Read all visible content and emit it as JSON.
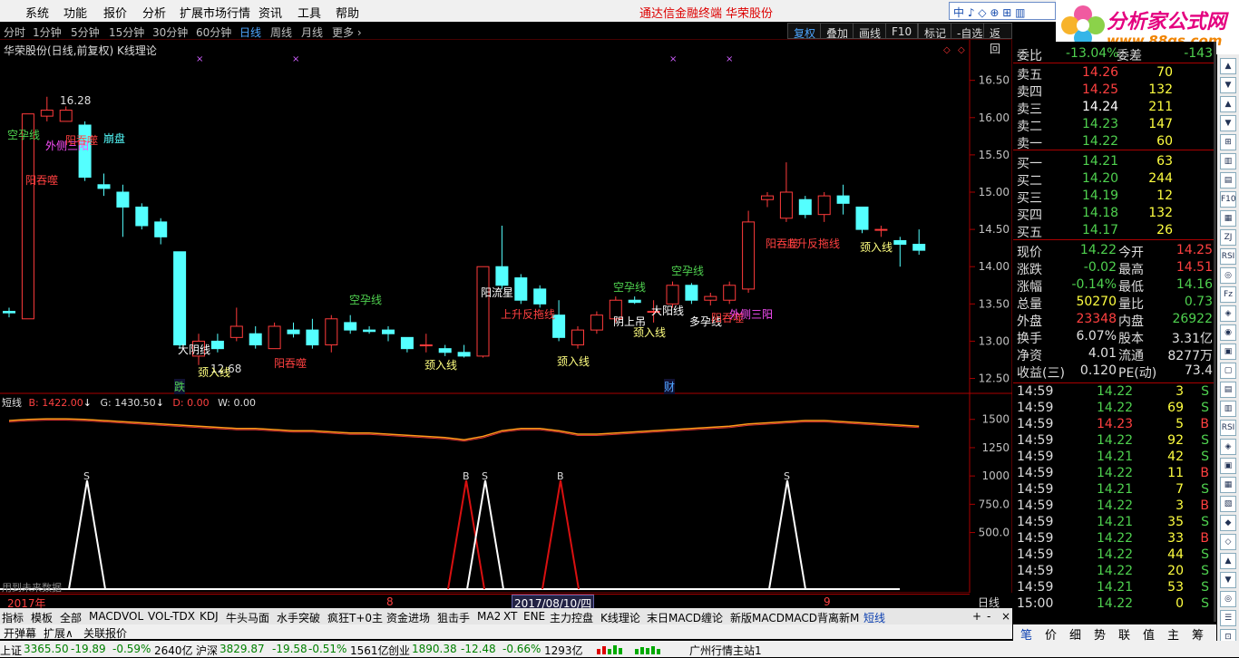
{
  "menu": {
    "items": [
      "系统",
      "功能",
      "报价",
      "分析",
      "扩展市场行情",
      "资讯",
      "工具",
      "帮助"
    ],
    "center_left": "通达信金融终端",
    "center_right": "华荣股份",
    "search_text": "中 ♪ ◇ ⊕ ⊞ ▥",
    "logo_title": "分析家公式网",
    "logo_url": "www.88gs.com"
  },
  "periods": {
    "items": [
      "分时",
      "1分钟",
      "5分钟",
      "15分钟",
      "30分钟",
      "60分钟",
      "日线",
      "周线",
      "月线",
      "更多 ›"
    ],
    "active": "日线",
    "buttons": [
      "复权",
      "叠加",
      "画线",
      "F10",
      "标记",
      "-自选",
      "返回"
    ]
  },
  "chart": {
    "title": "华荣股份(日线,前复权) K线理论",
    "yticks": [
      "16.50",
      "16.00",
      "15.50",
      "15.00",
      "14.50",
      "14.00",
      "13.50",
      "13.00",
      "12.50"
    ],
    "high_label": "16.28",
    "low_label": "12.68",
    "markers": {
      "die": "跌",
      "cai": "财"
    },
    "pattern_labels": [
      {
        "text": "空孕线",
        "x": 8,
        "y": 140,
        "color": "#4fd14f"
      },
      {
        "text": "外侧三阳",
        "x": 50,
        "y": 152,
        "color": "#ff4fff"
      },
      {
        "text": "阳吞噬",
        "x": 72,
        "y": 146,
        "color": "#ff4040"
      },
      {
        "text": "崩盘",
        "x": 114,
        "y": 144,
        "color": "#55ffff"
      },
      {
        "text": "阳吞噬",
        "x": 28,
        "y": 190,
        "color": "#ff4040"
      },
      {
        "text": "空孕线",
        "x": 385,
        "y": 322,
        "color": "#4fd14f"
      },
      {
        "text": "大阴线",
        "x": 196,
        "y": 377,
        "color": "#ffffff"
      },
      {
        "text": "颈入线",
        "x": 218,
        "y": 402,
        "color": "#ffff80"
      },
      {
        "text": "阳吞噬",
        "x": 302,
        "y": 392,
        "color": "#ff4040"
      },
      {
        "text": "颈入线",
        "x": 468,
        "y": 394,
        "color": "#ffff80"
      },
      {
        "text": "阳流星",
        "x": 530,
        "y": 314,
        "color": "#ffffff"
      },
      {
        "text": "上升反拖线",
        "x": 552,
        "y": 338,
        "color": "#ff4040"
      },
      {
        "text": "颈入线",
        "x": 614,
        "y": 390,
        "color": "#ffff80"
      },
      {
        "text": "空孕线",
        "x": 676,
        "y": 308,
        "color": "#4fd14f"
      },
      {
        "text": "阴上吊",
        "x": 676,
        "y": 346,
        "color": "#ffffff"
      },
      {
        "text": "大阳线",
        "x": 718,
        "y": 334,
        "color": "#ffffff"
      },
      {
        "text": "颈入线",
        "x": 698,
        "y": 358,
        "color": "#ffff80"
      },
      {
        "text": "空孕线",
        "x": 740,
        "y": 290,
        "color": "#4fd14f"
      },
      {
        "text": "多孕线",
        "x": 760,
        "y": 346,
        "color": "#ffffff"
      },
      {
        "text": "阳吞噬",
        "x": 784,
        "y": 342,
        "color": "#ff4040"
      },
      {
        "text": "外侧三阳",
        "x": 804,
        "y": 338,
        "color": "#ff4fff"
      },
      {
        "text": "阳吞噬",
        "x": 844,
        "y": 260,
        "color": "#ff4040"
      },
      {
        "text": "上升反拖线",
        "x": 866,
        "y": 260,
        "color": "#ff4040"
      },
      {
        "text": "颈入线",
        "x": 948,
        "y": 264,
        "color": "#ffff80"
      }
    ],
    "xaxis": {
      "year": "2017年",
      "m8": "8",
      "date": "2017/08/10/四",
      "m9": "9",
      "period": "日线"
    },
    "future_note": "用到未来数据"
  },
  "indicator": {
    "name": "短线",
    "b": "B: 1422.00",
    "g": "G: 1430.50",
    "d": "D: 0.00",
    "w": "W: 0.00",
    "yticks": [
      "1500",
      "1250",
      "1000",
      "750.0",
      "500.0"
    ],
    "signal_labels": [
      {
        "text": "S",
        "x": 96
      },
      {
        "text": "B",
        "x": 514
      },
      {
        "text": "S",
        "x": 535
      },
      {
        "text": "B",
        "x": 618
      },
      {
        "text": "S",
        "x": 868
      }
    ]
  },
  "chart_data": {
    "type": "candlestick",
    "title": "华荣股份(日线,前复权) K线理论",
    "ylim": [
      12.3,
      16.8
    ],
    "candles": [
      {
        "o": 13.4,
        "h": 13.45,
        "c": 13.38,
        "l": 13.32
      },
      {
        "o": 13.3,
        "h": 16.05,
        "c": 16.05,
        "l": 13.3
      },
      {
        "o": 16.02,
        "h": 16.28,
        "c": 16.1,
        "l": 15.95
      },
      {
        "o": 15.95,
        "h": 16.15,
        "c": 16.1,
        "l": 15.95
      },
      {
        "o": 15.9,
        "h": 15.95,
        "c": 15.2,
        "l": 15.15
      },
      {
        "o": 15.1,
        "h": 15.25,
        "c": 15.05,
        "l": 14.95
      },
      {
        "o": 15.0,
        "h": 15.1,
        "c": 14.8,
        "l": 14.4
      },
      {
        "o": 14.8,
        "h": 14.85,
        "c": 14.55,
        "l": 14.5
      },
      {
        "o": 14.6,
        "h": 14.65,
        "c": 14.4,
        "l": 14.3
      },
      {
        "o": 14.2,
        "h": 14.2,
        "c": 12.95,
        "l": 12.9
      },
      {
        "o": 12.8,
        "h": 13.1,
        "c": 13.0,
        "l": 12.68
      },
      {
        "o": 13.0,
        "h": 13.1,
        "c": 12.9,
        "l": 12.85
      },
      {
        "o": 13.05,
        "h": 13.45,
        "c": 13.2,
        "l": 13.0
      },
      {
        "o": 13.1,
        "h": 13.2,
        "c": 12.95,
        "l": 12.9
      },
      {
        "o": 12.9,
        "h": 13.25,
        "c": 13.2,
        "l": 12.9
      },
      {
        "o": 13.15,
        "h": 13.25,
        "c": 13.1,
        "l": 13.05
      },
      {
        "o": 13.15,
        "h": 13.3,
        "c": 12.95,
        "l": 12.9
      },
      {
        "o": 12.95,
        "h": 13.35,
        "c": 13.3,
        "l": 12.85
      },
      {
        "o": 13.25,
        "h": 13.35,
        "c": 13.15,
        "l": 13.1
      },
      {
        "o": 13.15,
        "h": 13.2,
        "c": 13.13,
        "l": 13.1
      },
      {
        "o": 13.15,
        "h": 13.2,
        "c": 13.1,
        "l": 13.0
      },
      {
        "o": 13.05,
        "h": 13.05,
        "c": 12.9,
        "l": 12.85
      },
      {
        "o": 12.95,
        "h": 13.1,
        "c": 12.95,
        "l": 12.85
      },
      {
        "o": 12.9,
        "h": 12.95,
        "c": 12.85,
        "l": 12.8
      },
      {
        "o": 12.85,
        "h": 12.95,
        "c": 12.8,
        "l": 12.78
      },
      {
        "o": 12.8,
        "h": 14.0,
        "c": 14.0,
        "l": 12.78
      },
      {
        "o": 14.0,
        "h": 14.55,
        "c": 13.75,
        "l": 13.7
      },
      {
        "o": 13.85,
        "h": 13.9,
        "c": 13.55,
        "l": 13.5
      },
      {
        "o": 13.7,
        "h": 13.75,
        "c": 13.5,
        "l": 13.45
      },
      {
        "o": 13.35,
        "h": 13.55,
        "c": 13.05,
        "l": 13.0
      },
      {
        "o": 12.95,
        "h": 13.2,
        "c": 13.15,
        "l": 12.9
      },
      {
        "o": 13.15,
        "h": 13.4,
        "c": 13.35,
        "l": 13.1
      },
      {
        "o": 13.3,
        "h": 13.6,
        "c": 13.55,
        "l": 13.25
      },
      {
        "o": 13.55,
        "h": 13.6,
        "c": 13.52,
        "l": 13.5
      },
      {
        "o": 13.4,
        "h": 13.55,
        "c": 13.4,
        "l": 13.25
      },
      {
        "o": 13.5,
        "h": 13.8,
        "c": 13.75,
        "l": 13.45
      },
      {
        "o": 13.75,
        "h": 13.78,
        "c": 13.55,
        "l": 13.5
      },
      {
        "o": 13.55,
        "h": 13.65,
        "c": 13.6,
        "l": 13.48
      },
      {
        "o": 13.55,
        "h": 13.8,
        "c": 13.75,
        "l": 13.5
      },
      {
        "o": 13.7,
        "h": 14.75,
        "c": 14.6,
        "l": 13.65
      },
      {
        "o": 14.9,
        "h": 15.0,
        "c": 14.95,
        "l": 14.8
      },
      {
        "o": 14.65,
        "h": 15.4,
        "c": 15.0,
        "l": 14.6
      },
      {
        "o": 14.9,
        "h": 14.95,
        "c": 14.7,
        "l": 14.65
      },
      {
        "o": 14.7,
        "h": 15.0,
        "c": 14.95,
        "l": 14.6
      },
      {
        "o": 14.95,
        "h": 15.1,
        "c": 14.85,
        "l": 14.7
      },
      {
        "o": 14.8,
        "h": 14.8,
        "c": 14.5,
        "l": 14.45
      },
      {
        "o": 14.5,
        "h": 14.55,
        "c": 14.5,
        "l": 14.4
      },
      {
        "o": 14.35,
        "h": 14.4,
        "c": 14.3,
        "l": 14.0
      },
      {
        "o": 14.3,
        "h": 14.5,
        "c": 14.22,
        "l": 14.16
      }
    ],
    "indicator_line_b": [
      1490,
      1500,
      1505,
      1505,
      1500,
      1490,
      1480,
      1470,
      1460,
      1450,
      1440,
      1430,
      1420,
      1420,
      1410,
      1400,
      1400,
      1390,
      1380,
      1380,
      1370,
      1360,
      1350,
      1340,
      1320,
      1350,
      1400,
      1420,
      1420,
      1400,
      1370,
      1370,
      1380,
      1390,
      1400,
      1410,
      1420,
      1430,
      1440,
      1460,
      1470,
      1480,
      1490,
      1490,
      1480,
      1470,
      1460,
      1450,
      1440
    ],
    "signals": [
      {
        "type": "S",
        "index": 4
      },
      {
        "type": "B",
        "index": 24
      },
      {
        "type": "S",
        "index": 25
      },
      {
        "type": "B",
        "index": 29
      },
      {
        "type": "S",
        "index": 41
      }
    ]
  },
  "quote": {
    "weibi_label": "委比",
    "weibi": "-13.04%",
    "weicha_label": "委差",
    "weicha": "-143",
    "asks": [
      {
        "label": "卖五",
        "price": "14.26",
        "vol": "70"
      },
      {
        "label": "卖四",
        "price": "14.25",
        "vol": "132"
      },
      {
        "label": "卖三",
        "price": "14.24",
        "vol": "211"
      },
      {
        "label": "卖二",
        "price": "14.23",
        "vol": "147"
      },
      {
        "label": "卖一",
        "price": "14.22",
        "vol": "60"
      }
    ],
    "bids": [
      {
        "label": "买一",
        "price": "14.21",
        "vol": "63"
      },
      {
        "label": "买二",
        "price": "14.20",
        "vol": "244"
      },
      {
        "label": "买三",
        "price": "14.19",
        "vol": "12"
      },
      {
        "label": "买四",
        "price": "14.18",
        "vol": "132"
      },
      {
        "label": "买五",
        "price": "14.17",
        "vol": "26"
      }
    ],
    "stats": [
      {
        "l1": "现价",
        "v1": "14.22",
        "c1": "#4fd14f",
        "l2": "今开",
        "v2": "14.25",
        "c2": "#ff4040"
      },
      {
        "l1": "涨跌",
        "v1": "-0.02",
        "c1": "#4fd14f",
        "l2": "最高",
        "v2": "14.51",
        "c2": "#ff4040"
      },
      {
        "l1": "涨幅",
        "v1": "-0.14%",
        "c1": "#4fd14f",
        "l2": "最低",
        "v2": "14.16",
        "c2": "#4fd14f"
      },
      {
        "l1": "总量",
        "v1": "50270",
        "c1": "#ffff40",
        "l2": "量比",
        "v2": "0.73",
        "c2": "#4fd14f"
      },
      {
        "l1": "外盘",
        "v1": "23348",
        "c1": "#ff4040",
        "l2": "内盘",
        "v2": "26922",
        "c2": "#4fd14f"
      },
      {
        "l1": "换手",
        "v1": "6.07%",
        "c1": "#e0e0e0",
        "l2": "股本",
        "v2": "3.31亿",
        "c2": "#e0e0e0"
      },
      {
        "l1": "净资",
        "v1": "4.01",
        "c1": "#e0e0e0",
        "l2": "流通",
        "v2": "8277万",
        "c2": "#e0e0e0"
      },
      {
        "l1": "收益(三)",
        "v1": "0.120",
        "c1": "#e0e0e0",
        "l2": "PE(动)",
        "v2": "73.4",
        "c2": "#e0e0e0"
      }
    ],
    "ticks": [
      {
        "t": "14:59",
        "p": "14.22",
        "v": "3",
        "s": "S"
      },
      {
        "t": "14:59",
        "p": "14.22",
        "v": "69",
        "s": "S"
      },
      {
        "t": "14:59",
        "p": "14.23",
        "v": "5",
        "s": "B"
      },
      {
        "t": "14:59",
        "p": "14.22",
        "v": "92",
        "s": "S"
      },
      {
        "t": "14:59",
        "p": "14.21",
        "v": "42",
        "s": "S"
      },
      {
        "t": "14:59",
        "p": "14.22",
        "v": "11",
        "s": "B"
      },
      {
        "t": "14:59",
        "p": "14.21",
        "v": "7",
        "s": "S"
      },
      {
        "t": "14:59",
        "p": "14.22",
        "v": "3",
        "s": "B"
      },
      {
        "t": "14:59",
        "p": "14.21",
        "v": "35",
        "s": "S"
      },
      {
        "t": "14:59",
        "p": "14.22",
        "v": "33",
        "s": "B"
      },
      {
        "t": "14:59",
        "p": "14.22",
        "v": "44",
        "s": "S"
      },
      {
        "t": "14:59",
        "p": "14.22",
        "v": "20",
        "s": "S"
      },
      {
        "t": "14:59",
        "p": "14.21",
        "v": "53",
        "s": "S"
      },
      {
        "t": "15:00",
        "p": "14.22",
        "v": "0",
        "s": "S"
      }
    ],
    "tabs": [
      "笔",
      "价",
      "细",
      "势",
      "联",
      "值",
      "主",
      "筹"
    ]
  },
  "indicator_tabs": [
    "指标",
    "模板",
    "全部",
    "MACD",
    "VOL",
    "VOL-TDX",
    "KDJ",
    "牛头马面",
    "水手突破",
    "疯狂T+0主",
    "资金进场",
    "狙击手",
    "MA2",
    "XT",
    "ENE",
    "主力控盘",
    "K线理论",
    "末日MACD",
    "缠论",
    "新版MACD",
    "MACD背离",
    "新M",
    "短线"
  ],
  "indicator_tabs_selected": "短线",
  "bottom_tabs": [
    "开弹幕",
    "扩展∧",
    "关联报价"
  ],
  "status": {
    "sh_label": "上证",
    "sh": "3365.50",
    "sh_chg": "-19.89",
    "sh_pct": "-0.59%",
    "sh_amt": "2640亿",
    "sz_label": "沪深",
    "sz": "3829.87",
    "sz_chg": "-19.58",
    "sz_pct": "-0.51%",
    "sz_amt": "1561亿",
    "cy_label": "创业",
    "cy": "1890.38",
    "cy_chg": "-12.48",
    "cy_pct": "-0.66%",
    "cy_amt": "1293亿",
    "server": "广州行情主站1"
  },
  "sidebar_icons": [
    "▲",
    "▼",
    "▲",
    "▼",
    "⊞",
    "▥",
    "▤",
    "F10",
    "▦",
    "ZJ",
    "RSI",
    "◎",
    "Fz",
    "◈",
    "◉",
    "▣",
    "▢",
    "▤",
    "▥",
    "RSI",
    "◈",
    "▣",
    "▦",
    "▧",
    "◆",
    "◇",
    "▲",
    "▼",
    "◎",
    "☰",
    "⊡"
  ]
}
